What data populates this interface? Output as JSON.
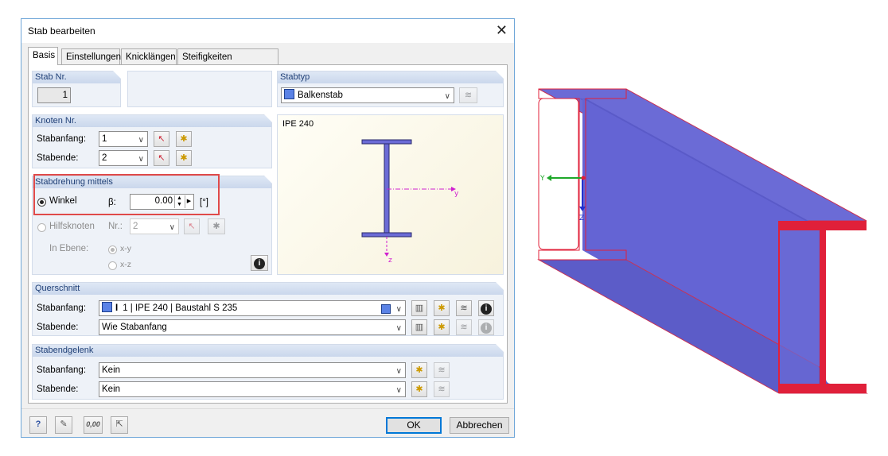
{
  "dialog": {
    "title": "Stab bearbeiten",
    "close_glyph": "✕",
    "tabs": [
      "Basis",
      "Einstellungen",
      "Knicklängen",
      "Steifigkeiten modifizieren"
    ]
  },
  "stab_nr": {
    "header": "Stab Nr.",
    "value": "1"
  },
  "stabtyp": {
    "header": "Stabtyp",
    "selected": "Balkenstab"
  },
  "knoten": {
    "header": "Knoten Nr.",
    "start_label": "Stabanfang:",
    "start_value": "1",
    "end_label": "Stabende:",
    "end_value": "2"
  },
  "preview": {
    "section_label": "IPE 240",
    "axis_y": "y",
    "axis_z": "z"
  },
  "rotation": {
    "header": "Stabdrehung mittels",
    "winkel_label": "Winkel",
    "beta_label": "β:",
    "beta_value": "0.00",
    "unit": "[°]",
    "hilfsknoten_label": "Hilfsknoten",
    "nr_label": "Nr.:",
    "nr_value": "2",
    "ebene_label": "In Ebene:",
    "xy_label": "x-y",
    "xz_label": "x-z"
  },
  "querschnitt": {
    "header": "Querschnitt",
    "start_label": "Stabanfang:",
    "start_icon": "I",
    "start_value": "1 | IPE 240 | Baustahl S 235",
    "end_label": "Stabende:",
    "end_value": "Wie Stabanfang"
  },
  "gelenk": {
    "header": "Stabendgelenk",
    "start_label": "Stabanfang:",
    "start_value": "Kein",
    "end_label": "Stabende:",
    "end_value": "Kein"
  },
  "footer": {
    "calc_icon_text": "0,00",
    "ok_label": "OK",
    "cancel_label": "Abbrechen"
  },
  "view3d": {
    "axis_y": "Y",
    "axis_z": "Z"
  },
  "colors": {
    "beam_fill": "#6b6bd6",
    "flange_red": "#e0203a",
    "header_text": "#1f3f76",
    "highlight": "#e04a4a"
  }
}
